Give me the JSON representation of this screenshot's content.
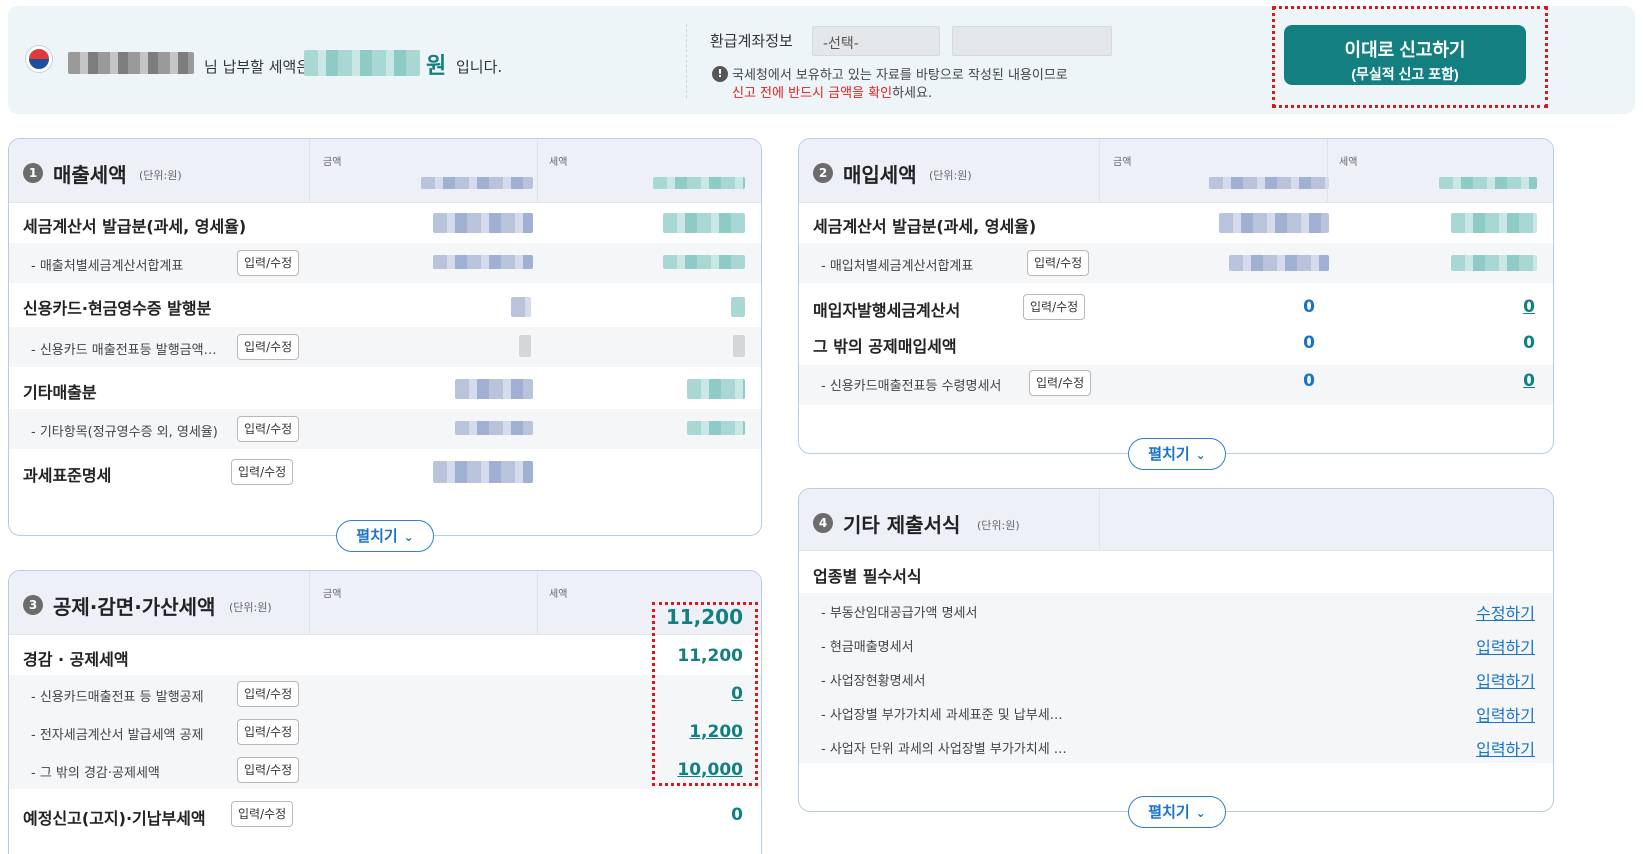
{
  "banner": {
    "sentence_part1": "님 납부할 세액은",
    "won": "원",
    "sentence_part2": "입니다.",
    "refund_label": "환급계좌정보",
    "refund_select": "-선택-",
    "info_icon": "!",
    "notice_line1": "국세청에서 보유하고 있는 자료를 바탕으로 작성된 내용이므로",
    "notice_red": "신고 전에 반드시 금액을 확인",
    "notice_tail": "하세요.",
    "submit_line1": "이대로 신고하기",
    "submit_line2": "(무실적 신고 포함)"
  },
  "common": {
    "amount_col": "금액",
    "tax_col": "세액",
    "unit": "(단위:원)",
    "edit": "입력/수정",
    "expand": "펼치기",
    "chevron": "⌄"
  },
  "sales": {
    "num": "1",
    "title": "매출세액",
    "row1": "세금계산서 발급분(과세, 영세율)",
    "row1_sub": "- 매출처별세금계산서합계표",
    "row2": "신용카드·현금영수증 발행분",
    "row2_sub": "- 신용카드 매출전표등 발행금액…",
    "row3": "기타매출분",
    "row3_sub": "- 기타항목(정규영수증 외, 영세율)",
    "row4": "과세표준명세"
  },
  "purchase": {
    "num": "2",
    "title": "매입세액",
    "row1": "세금계산서 발급분(과세, 영세율)",
    "row1_sub": "- 매입처별세금계산서합계표",
    "row2": "매입자발행세금계산서",
    "row2_amount": "0",
    "row2_tax": "0",
    "row3": "그 밖의 공제매입세액",
    "row3_amount": "0",
    "row3_tax": "0",
    "row3_sub": "- 신용카드매출전표등 수령명세서",
    "row3_sub_amount": "0",
    "row3_sub_tax": "0"
  },
  "deduction": {
    "num": "3",
    "title": "공제·감면·가산세액",
    "header_tax": "11,200",
    "row1": "경감 · 공제세액",
    "row1_tax": "11,200",
    "sub1": "- 신용카드매출전표 등 발행공제",
    "sub1_tax": "0",
    "sub2": "- 전자세금계산서 발급세액 공제",
    "sub2_tax": "1,200",
    "sub3": "- 그 밖의 경감·공제세액",
    "sub3_tax": "10,000",
    "row2": "예정신고(고지)·기납부세액",
    "row2_tax": "0"
  },
  "other": {
    "num": "4",
    "title": "기타 제출서식",
    "section": "업종별 필수서식",
    "items": [
      {
        "label": "- 부동산임대공급가액 명세서",
        "action": "수정하기"
      },
      {
        "label": "- 현금매출명세서",
        "action": "입력하기"
      },
      {
        "label": "- 사업장현황명세서",
        "action": "입력하기"
      },
      {
        "label": "- 사업장별 부가가치세 과세표준 및 납부세…",
        "action": "입력하기"
      },
      {
        "label": "- 사업자 단위 과세의 사업장별 부가가치세 …",
        "action": "입력하기"
      }
    ]
  },
  "colors": {
    "accent": "#137f80",
    "link": "#1a73c7",
    "alert": "#e02020",
    "border": "#b9cce3"
  }
}
